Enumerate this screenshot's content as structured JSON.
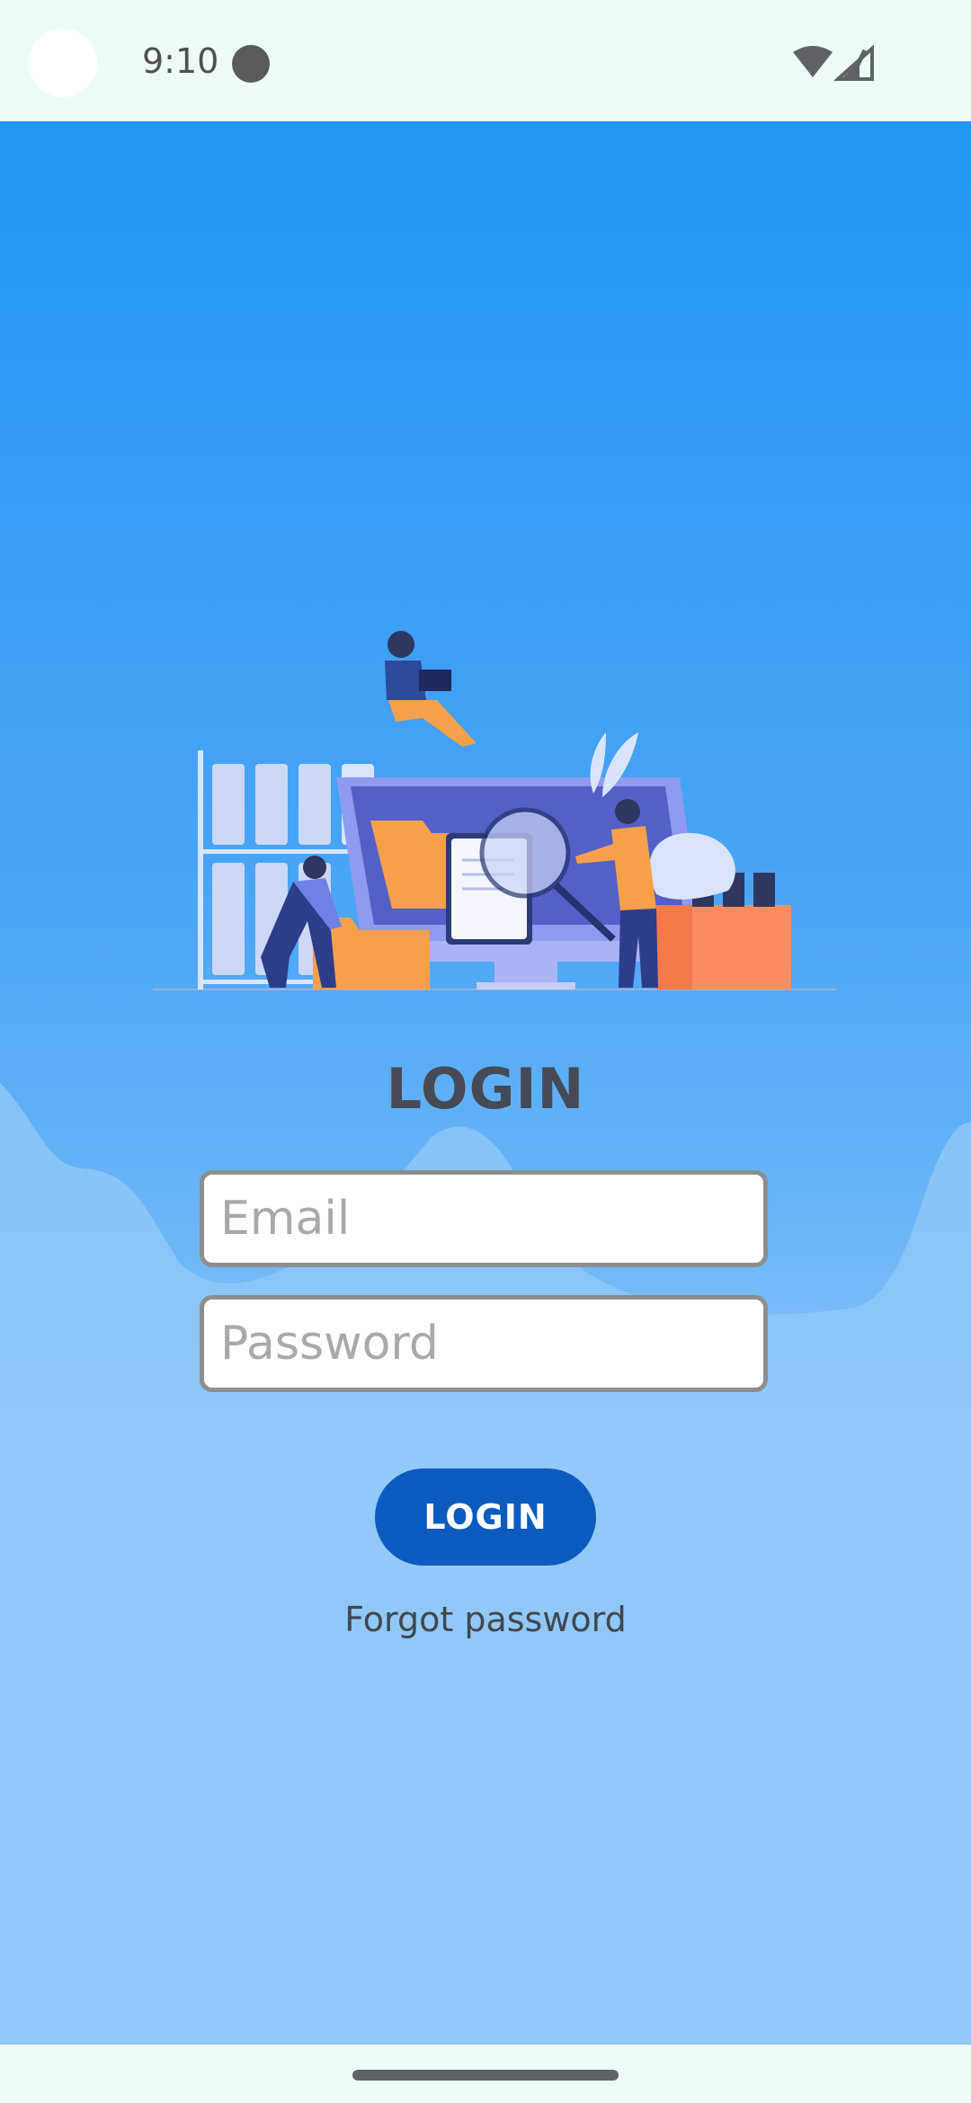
{
  "status_bar": {
    "time": "9:10"
  },
  "screen": {
    "title": "LOGIN",
    "email": {
      "placeholder": "Email",
      "value": ""
    },
    "password": {
      "placeholder": "Password",
      "value": ""
    },
    "login_button_label": "LOGIN",
    "forgot_password_label": "Forgot password"
  },
  "colors": {
    "background_top": "#2196f3",
    "background_bottom": "#93c9f8",
    "login_button": "#0b5cbe",
    "title_text": "#454a55"
  },
  "icons": [
    "wifi-icon",
    "signal-icon",
    "documents-illustration"
  ]
}
